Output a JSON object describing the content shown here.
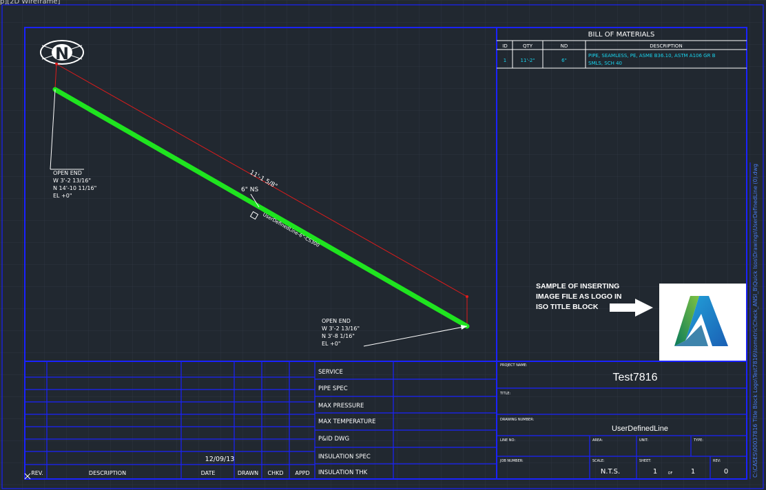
{
  "viewport": {
    "label": "p][2D Wireframe]"
  },
  "north_arrow": {
    "letter": "N"
  },
  "bom": {
    "title": "BILL OF MATERIALS",
    "headers": [
      "ID",
      "QTY",
      "ND",
      "DESCRIPTION"
    ],
    "rows": [
      {
        "id": "1",
        "qty": "11'-2\"",
        "nd": "6\"",
        "description_line1": "PIPE, SEAMLESS, PE, ASME B36.10, ASTM A106 GR B",
        "description_line2": "SMLS, SCH 40"
      }
    ]
  },
  "drawing": {
    "dimension_label": "11'-1 5/8\"",
    "size_label": "6\" NS",
    "line_tag": "UserDefinedLine-6\"-CS300",
    "open_end_top": {
      "line1": "OPEN END",
      "line2": "W 3'-2 13/16\"",
      "line3": "N 14'-10 11/16\"",
      "line4": "EL +0\""
    },
    "open_end_bottom": {
      "line1": "OPEN END",
      "line2": "W 3'-2 13/16\"",
      "line3": "N 3'-8 1/16\"",
      "line4": "EL +0\""
    }
  },
  "logo_note": {
    "line1": "SAMPLE OF INSERTING",
    "line2": "IMAGE FILE AS LOGO IN",
    "line3": "ISO TITLE BLOCK"
  },
  "file_path": "C:\\CASES\\00037816 Title Block Logo\\Test7816\\Isometric\\Check_ANSI_B\\Quick Isos\\Drawings\\UserDefinedLine (0).dwg",
  "revision_block": {
    "date_entry": "12/09/13",
    "headers": {
      "rev": "REV.",
      "description": "DESCRIPTION",
      "date": "DATE",
      "drawn": "DRAWN",
      "chkd": "CHKD",
      "appd": "APPD"
    }
  },
  "properties": {
    "service": "SERVICE",
    "pipe_spec": "PIPE SPEC",
    "max_pressure": "MAX PRESSURE",
    "max_temperature": "MAX TEMPERATURE",
    "pid_dwg": "P&ID DWG",
    "insulation_spec": "INSULATION SPEC",
    "insulation_thk": "INSULATION THK"
  },
  "title_block": {
    "project_name_label": "PROJECT NAME:",
    "project_name": "Test7816",
    "title_label": "TITLE:",
    "drawing_number_label": "DRAWING NUMBER:",
    "drawing_number": "UserDefinedLine",
    "line_no_label": "LINE NO:",
    "area_label": "AREA:",
    "unit_label": "UNIT:",
    "type_label": "TYPE:",
    "job_number_label": "JOB NUMBER:",
    "scale_label": "SCALE:",
    "scale": "N.T.S.",
    "sheet_label": "SHEET:",
    "sheet": "1",
    "of_label": "OF",
    "sheet_total": "1",
    "rev_label": "REV:",
    "rev": "0"
  },
  "colors": {
    "background": "#212830",
    "border": "#1a22ff",
    "pipe": "#1fe41f",
    "dimension": "#e01b1b",
    "text": "#ffffff",
    "bom_text": "#19d4ee"
  }
}
